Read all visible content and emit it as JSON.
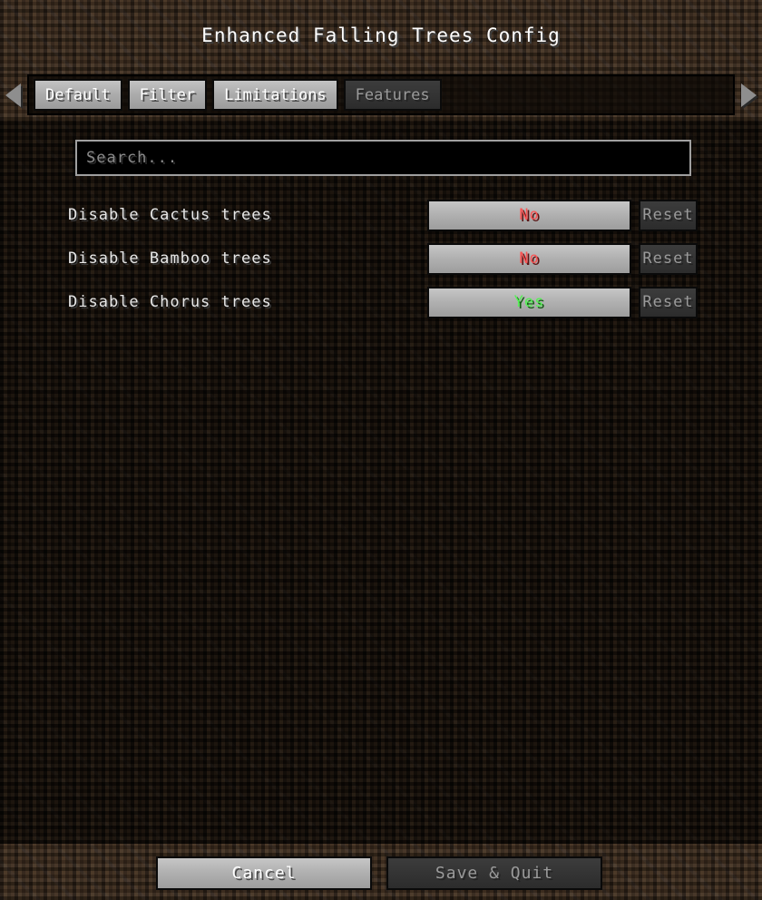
{
  "window": {
    "title": "Enhanced Falling Trees Config"
  },
  "tabs": {
    "scroll_left_icon": "triangle-left-icon",
    "scroll_right_icon": "triangle-right-icon",
    "items": [
      {
        "label": "Default",
        "state": "inactive"
      },
      {
        "label": "Filter",
        "state": "inactive"
      },
      {
        "label": "Limitations",
        "state": "inactive"
      },
      {
        "label": "Features",
        "state": "active"
      }
    ]
  },
  "search": {
    "value": "",
    "placeholder": "Search..."
  },
  "options": [
    {
      "label": "Disable Cactus trees",
      "value": "No",
      "value_state": "no",
      "reset_label": "Reset"
    },
    {
      "label": "Disable Bamboo trees",
      "value": "No",
      "value_state": "no",
      "reset_label": "Reset"
    },
    {
      "label": "Disable Chorus trees",
      "value": "Yes",
      "value_state": "yes",
      "reset_label": "Reset"
    }
  ],
  "footer": {
    "cancel_label": "Cancel",
    "save_quit_label": "Save & Quit"
  },
  "colors": {
    "value_no": "#fc5555",
    "value_yes": "#55f255",
    "button_light": "#b1b1b1",
    "button_dark": "#343434",
    "text_primary": "#ffffff",
    "text_dim": "#9a9a9a",
    "dirt_light": "#3b2b1e",
    "dirt_dark": "#130d08"
  }
}
